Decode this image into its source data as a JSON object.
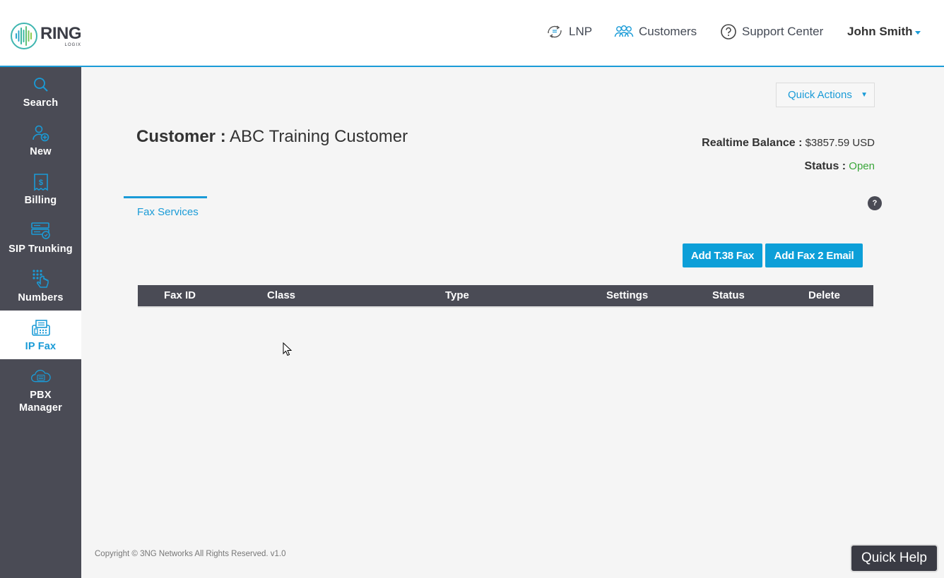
{
  "brand": {
    "name": "RING",
    "sub": "LOGIX"
  },
  "topnav": {
    "lnp": "LNP",
    "customers": "Customers",
    "support": "Support Center",
    "user": "John Smith"
  },
  "sidebar": {
    "items": [
      {
        "label": "Search",
        "icon": "search-icon"
      },
      {
        "label": "New",
        "icon": "new-user-icon"
      },
      {
        "label": "Billing",
        "icon": "billing-icon"
      },
      {
        "label": "SIP Trunking",
        "icon": "sip-trunking-icon"
      },
      {
        "label": "Numbers",
        "icon": "numbers-icon"
      },
      {
        "label": "IP Fax",
        "icon": "fax-icon",
        "active": true
      },
      {
        "label": "PBX\nManager",
        "icon": "pbx-cloud-icon"
      }
    ]
  },
  "main": {
    "quick_actions": "Quick Actions",
    "customer_label": "Customer :",
    "customer_name": "ABC Training Customer",
    "balance_label": "Realtime Balance :",
    "balance_value": "$3857.59 USD",
    "status_label": "Status :",
    "status_value": "Open",
    "tab": "Fax Services",
    "help": "?",
    "buttons": {
      "add_t38": "Add T.38 Fax",
      "add_f2e": "Add Fax 2 Email"
    },
    "table": {
      "columns": [
        "Fax ID",
        "Class",
        "Type",
        "Settings",
        "Status",
        "Delete"
      ],
      "rows": []
    }
  },
  "footer": {
    "copyright": "Copyright © 3NG Networks All Rights Reserved. v1.0",
    "quick_help": "Quick Help"
  },
  "colors": {
    "accent": "#1a9bd7",
    "sidebar": "#4a4b55",
    "button": "#0d9fd8",
    "status_open": "#3aa63a"
  }
}
